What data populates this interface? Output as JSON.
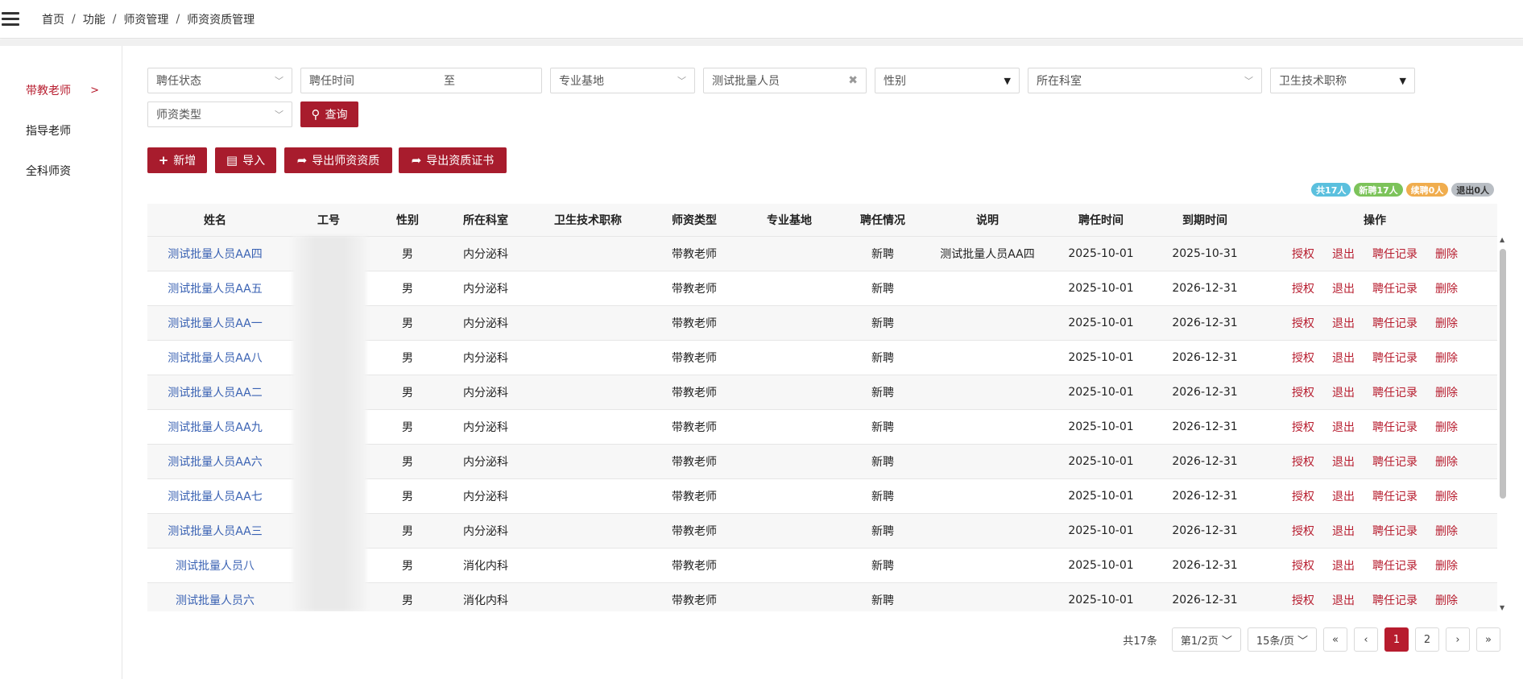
{
  "breadcrumb": [
    "首页",
    "功能",
    "师资管理",
    "师资资质管理"
  ],
  "sidebar": {
    "items": [
      {
        "label": "带教老师",
        "active": true
      },
      {
        "label": "指导老师",
        "active": false
      },
      {
        "label": "全科师资",
        "active": false
      }
    ]
  },
  "filters": {
    "appoint_status": "聘任状态",
    "appoint_time": "聘任时间",
    "to": "至",
    "base": "专业基地",
    "keyword": "测试批量人员",
    "gender": "性别",
    "department": "所在科室",
    "title": "卫生技术职称",
    "teacher_type": "师资类型",
    "search_label": "查询"
  },
  "actions": {
    "add": "新增",
    "import": "导入",
    "export_qualification": "导出师资资质",
    "export_certificate": "导出资质证书"
  },
  "badges": [
    {
      "label": "共17人",
      "color": "#5bc0de"
    },
    {
      "label": "新聘17人",
      "color": "#7cc35a"
    },
    {
      "label": "续聘0人",
      "color": "#f0ad4e"
    },
    {
      "label": "退出0人",
      "color": "#b9bec4"
    }
  ],
  "table": {
    "headers": [
      "姓名",
      "工号",
      "性别",
      "所在科室",
      "卫生技术职称",
      "师资类型",
      "专业基地",
      "聘任情况",
      "说明",
      "聘任时间",
      "到期时间",
      "操作"
    ],
    "ops": [
      "授权",
      "退出",
      "聘任记录",
      "删除"
    ],
    "rows": [
      {
        "name": "测试批量人员AA四",
        "gender": "男",
        "dept": "内分泌科",
        "title": "",
        "type": "带教老师",
        "base": "",
        "status": "新聘",
        "note": "测试批量人员AA四",
        "start": "2025-10-01",
        "end": "2025-10-31"
      },
      {
        "name": "测试批量人员AA五",
        "gender": "男",
        "dept": "内分泌科",
        "title": "",
        "type": "带教老师",
        "base": "",
        "status": "新聘",
        "note": "",
        "start": "2025-10-01",
        "end": "2026-12-31"
      },
      {
        "name": "测试批量人员AA一",
        "gender": "男",
        "dept": "内分泌科",
        "title": "",
        "type": "带教老师",
        "base": "",
        "status": "新聘",
        "note": "",
        "start": "2025-10-01",
        "end": "2026-12-31"
      },
      {
        "name": "测试批量人员AA八",
        "gender": "男",
        "dept": "内分泌科",
        "title": "",
        "type": "带教老师",
        "base": "",
        "status": "新聘",
        "note": "",
        "start": "2025-10-01",
        "end": "2026-12-31"
      },
      {
        "name": "测试批量人员AA二",
        "gender": "男",
        "dept": "内分泌科",
        "title": "",
        "type": "带教老师",
        "base": "",
        "status": "新聘",
        "note": "",
        "start": "2025-10-01",
        "end": "2026-12-31"
      },
      {
        "name": "测试批量人员AA九",
        "gender": "男",
        "dept": "内分泌科",
        "title": "",
        "type": "带教老师",
        "base": "",
        "status": "新聘",
        "note": "",
        "start": "2025-10-01",
        "end": "2026-12-31"
      },
      {
        "name": "测试批量人员AA六",
        "gender": "男",
        "dept": "内分泌科",
        "title": "",
        "type": "带教老师",
        "base": "",
        "status": "新聘",
        "note": "",
        "start": "2025-10-01",
        "end": "2026-12-31"
      },
      {
        "name": "测试批量人员AA七",
        "gender": "男",
        "dept": "内分泌科",
        "title": "",
        "type": "带教老师",
        "base": "",
        "status": "新聘",
        "note": "",
        "start": "2025-10-01",
        "end": "2026-12-31"
      },
      {
        "name": "测试批量人员AA三",
        "gender": "男",
        "dept": "内分泌科",
        "title": "",
        "type": "带教老师",
        "base": "",
        "status": "新聘",
        "note": "",
        "start": "2025-10-01",
        "end": "2026-12-31"
      },
      {
        "name": "测试批量人员八",
        "gender": "男",
        "dept": "消化内科",
        "title": "",
        "type": "带教老师",
        "base": "",
        "status": "新聘",
        "note": "",
        "start": "2025-10-01",
        "end": "2026-12-31"
      },
      {
        "name": "测试批量人员六",
        "gender": "男",
        "dept": "消化内科",
        "title": "",
        "type": "带教老师",
        "base": "",
        "status": "新聘",
        "note": "",
        "start": "2025-10-01",
        "end": "2026-12-31"
      }
    ]
  },
  "pagination": {
    "total": "共17条",
    "page_select": "第1/2页",
    "size_select": "15条/页",
    "first": "«",
    "prev": "‹",
    "pages": [
      "1",
      "2"
    ],
    "next": "›",
    "last": "»"
  }
}
